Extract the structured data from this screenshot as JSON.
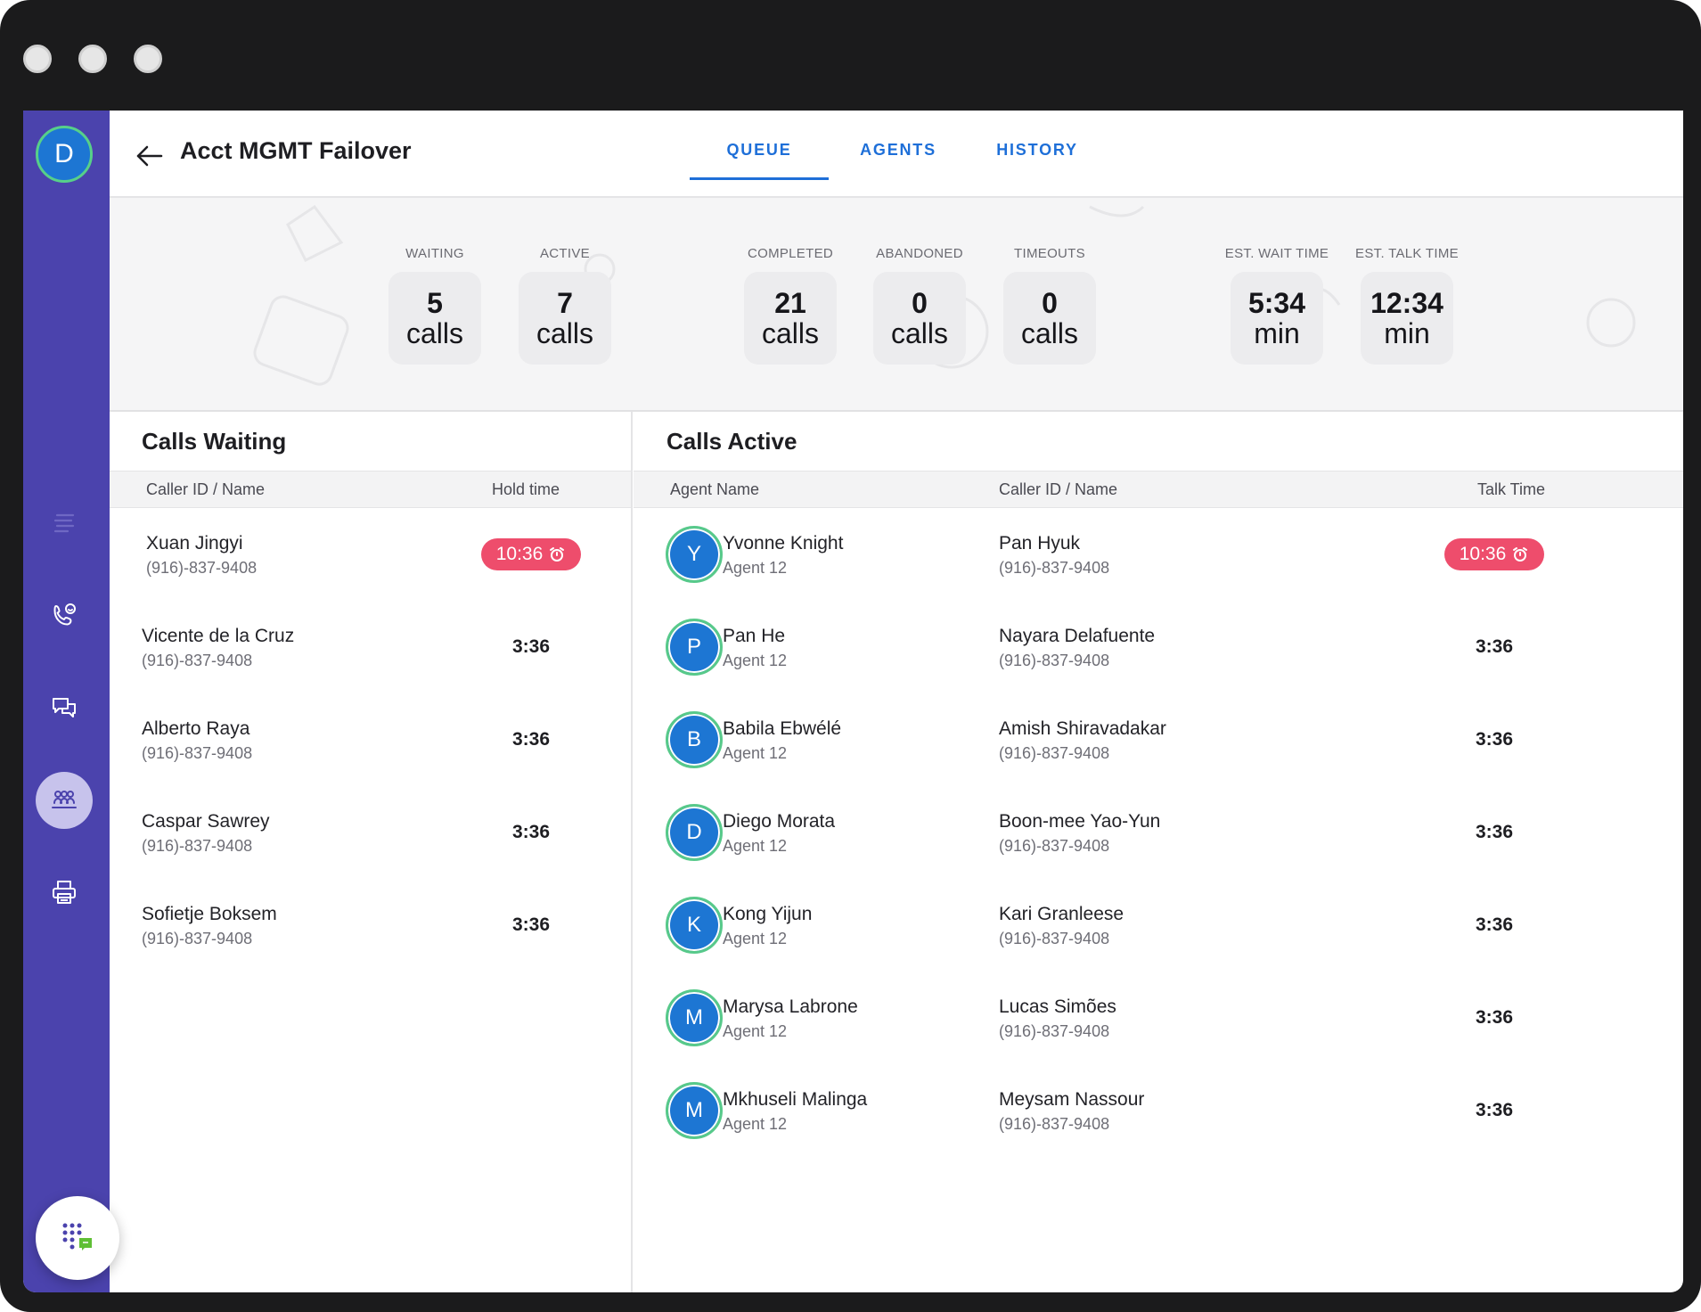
{
  "sidebar": {
    "avatar_initial": "D",
    "icons": [
      "list-icon",
      "phone-agent-icon",
      "chat-icon",
      "team-icon",
      "printer-icon"
    ],
    "active_icon": "team-icon",
    "fab_icon": "dialpad-chat-icon"
  },
  "header": {
    "title": "Acct MGMT Failover",
    "tabs": [
      "QUEUE",
      "AGENTS",
      "HISTORY"
    ],
    "active_tab": "QUEUE"
  },
  "stats": [
    {
      "label": "WAITING",
      "value": "5",
      "unit": "calls"
    },
    {
      "label": "ACTIVE",
      "value": "7",
      "unit": "calls"
    },
    {
      "label": "COMPLETED",
      "value": "21",
      "unit": "calls"
    },
    {
      "label": "ABANDONED",
      "value": "0",
      "unit": "calls"
    },
    {
      "label": "TIMEOUTS",
      "value": "0",
      "unit": "calls"
    },
    {
      "label": "EST. WAIT TIME",
      "value": "5:34",
      "unit": "min"
    },
    {
      "label": "EST. TALK TIME",
      "value": "12:34",
      "unit": "min"
    }
  ],
  "waiting": {
    "title": "Calls Waiting",
    "col_caller": "Caller ID / Name",
    "col_hold": "Hold time",
    "rows": [
      {
        "name": "Xuan Jingyi",
        "phone": "(916)-837-9408",
        "time": "10:36",
        "alert": true
      },
      {
        "name": "Vicente de la Cruz",
        "phone": "(916)-837-9408",
        "time": "3:36",
        "alert": false
      },
      {
        "name": "Alberto Raya",
        "phone": "(916)-837-9408",
        "time": "3:36",
        "alert": false
      },
      {
        "name": "Caspar Sawrey",
        "phone": "(916)-837-9408",
        "time": "3:36",
        "alert": false
      },
      {
        "name": "Sofietje Boksem",
        "phone": "(916)-837-9408",
        "time": "3:36",
        "alert": false
      }
    ]
  },
  "active": {
    "title": "Calls Active",
    "col_agent": "Agent Name",
    "col_caller": "Caller ID / Name",
    "col_talk": "Talk Time",
    "rows": [
      {
        "initial": "Y",
        "agent": "Yvonne Knight",
        "agent_sub": "Agent 12",
        "caller": "Pan Hyuk",
        "phone": "(916)-837-9408",
        "time": "10:36",
        "alert": true
      },
      {
        "initial": "P",
        "agent": "Pan He",
        "agent_sub": "Agent 12",
        "caller": "Nayara Delafuente",
        "phone": "(916)-837-9408",
        "time": "3:36",
        "alert": false
      },
      {
        "initial": "B",
        "agent": "Babila Ebwélé",
        "agent_sub": "Agent 12",
        "caller": "Amish Shiravadakar",
        "phone": "(916)-837-9408",
        "time": "3:36",
        "alert": false
      },
      {
        "initial": "D",
        "agent": "Diego Morata",
        "agent_sub": "Agent 12",
        "caller": "Boon-mee Yao-Yun",
        "phone": "(916)-837-9408",
        "time": "3:36",
        "alert": false
      },
      {
        "initial": "K",
        "agent": "Kong Yijun",
        "agent_sub": "Agent 12",
        "caller": "Kari Granleese",
        "phone": "(916)-837-9408",
        "time": "3:36",
        "alert": false
      },
      {
        "initial": "M",
        "agent": "Marysa Labrone",
        "agent_sub": "Agent 12",
        "caller": "Lucas Simões",
        "phone": "(916)-837-9408",
        "time": "3:36",
        "alert": false
      },
      {
        "initial": "M",
        "agent": "Mkhuseli Malinga",
        "agent_sub": "Agent 12",
        "caller": "Meysam Nassour",
        "phone": "(916)-837-9408",
        "time": "3:36",
        "alert": false
      }
    ]
  },
  "colors": {
    "sidebar": "#4b43ad",
    "accent": "#1e6fd8",
    "alert": "#ee4d6c",
    "avatar": "#1d76d3",
    "avatar_ring": "#57c98a"
  }
}
